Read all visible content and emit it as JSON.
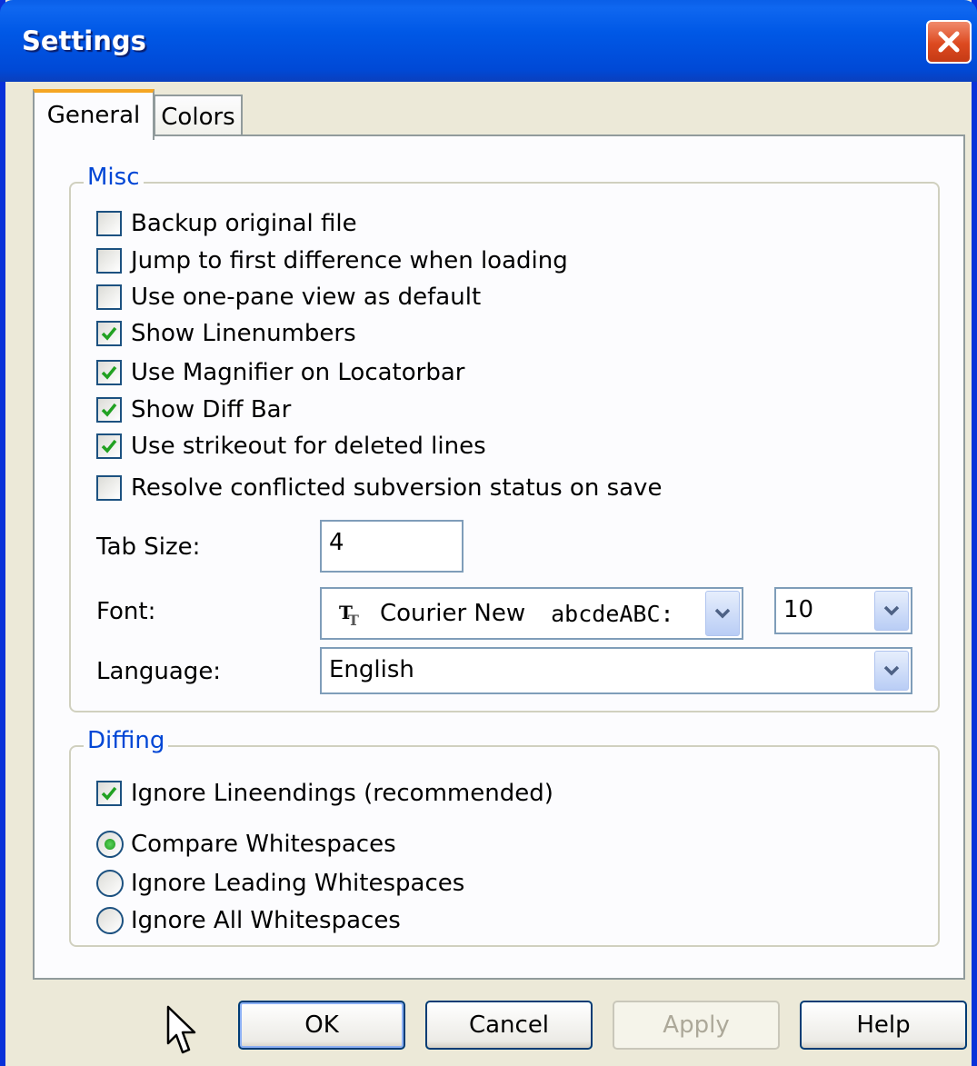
{
  "window": {
    "title": "Settings",
    "accent_color": "#0058e6",
    "close_icon": "close-icon"
  },
  "tabs": [
    {
      "label": "General",
      "selected": true
    },
    {
      "label": "Colors",
      "selected": false
    }
  ],
  "misc": {
    "title": "Misc",
    "options": [
      {
        "label": "Backup original file",
        "checked": false
      },
      {
        "label": "Jump to first difference when loading",
        "checked": false
      },
      {
        "label": "Use one-pane view as default",
        "checked": false
      },
      {
        "label": "Show Linenumbers",
        "checked": true
      },
      {
        "label": "Use Magnifier on Locatorbar",
        "checked": true
      },
      {
        "label": "Show Diff Bar",
        "checked": true
      },
      {
        "label": "Use strikeout for deleted lines",
        "checked": true
      },
      {
        "label": "Resolve conflicted subversion status on save",
        "checked": false
      }
    ],
    "tab_size": {
      "label": "Tab Size:",
      "value": "4"
    },
    "font": {
      "label": "Font:",
      "name": "Courier New",
      "sample": "abcdeABC:",
      "size": "10",
      "icon": "truetype-font-icon"
    },
    "language": {
      "label": "Language:",
      "value": "English"
    }
  },
  "diffing": {
    "title": "Diffing",
    "ignore_lineendings": {
      "label": "Ignore Lineendings (recommended)",
      "checked": true
    },
    "whitespace_options": [
      {
        "label": "Compare Whitespaces",
        "selected": true
      },
      {
        "label": "Ignore Leading Whitespaces",
        "selected": false
      },
      {
        "label": "Ignore All Whitespaces",
        "selected": false
      }
    ]
  },
  "buttons": {
    "ok": "OK",
    "cancel": "Cancel",
    "apply": "Apply",
    "help": "Help"
  }
}
